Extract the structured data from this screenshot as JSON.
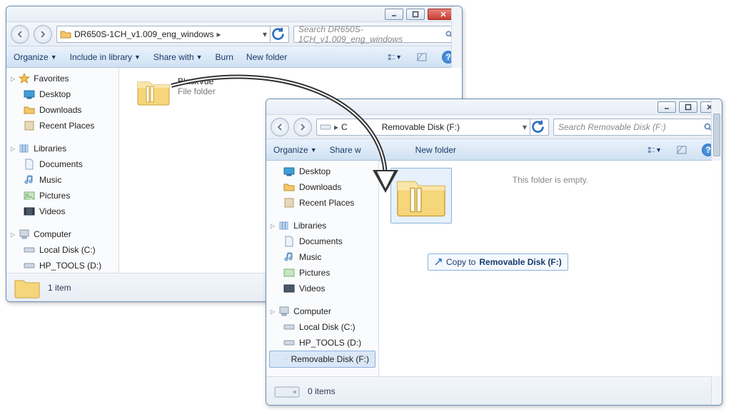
{
  "win1": {
    "title_buttons": {
      "min": "–",
      "max": "□",
      "close": "✕"
    },
    "path_label": "DR650S-1CH_v1.009_eng_windows",
    "search_placeholder": "Search DR650S-1CH_v1.009_eng_windows",
    "toolbar": {
      "organize": "Organize",
      "include": "Include in library",
      "share": "Share with",
      "burn": "Burn",
      "newfolder": "New folder"
    },
    "nav": {
      "favorites": "Favorites",
      "desktop": "Desktop",
      "downloads": "Downloads",
      "recent": "Recent Places",
      "libraries": "Libraries",
      "documents": "Documents",
      "music": "Music",
      "pictures": "Pictures",
      "videos": "Videos",
      "computer": "Computer",
      "localc": "Local Disk (C:)",
      "hptools": "HP_TOOLS (D:)"
    },
    "item": {
      "name": "BlackVue",
      "type": "File folder"
    },
    "status": "1 item"
  },
  "win2": {
    "path_prefix": "C",
    "path_label": "Removable Disk (F:)",
    "search_placeholder": "Search Removable Disk (F:)",
    "toolbar": {
      "organize": "Organize",
      "share": "Share w",
      "newfolder": "New folder"
    },
    "nav": {
      "desktop": "Desktop",
      "downloads": "Downloads",
      "recent": "Recent Places",
      "libraries": "Libraries",
      "documents": "Documents",
      "music": "Music",
      "pictures": "Pictures",
      "videos": "Videos",
      "computer": "Computer",
      "localc": "Local Disk (C:)",
      "hptools": "HP_TOOLS (D:)",
      "removable": "Removable Disk (F:)"
    },
    "empty": "This folder is empty.",
    "copytip_prefix": "Copy to ",
    "copytip_target": "Removable Disk (F:)",
    "status": "0 items"
  }
}
